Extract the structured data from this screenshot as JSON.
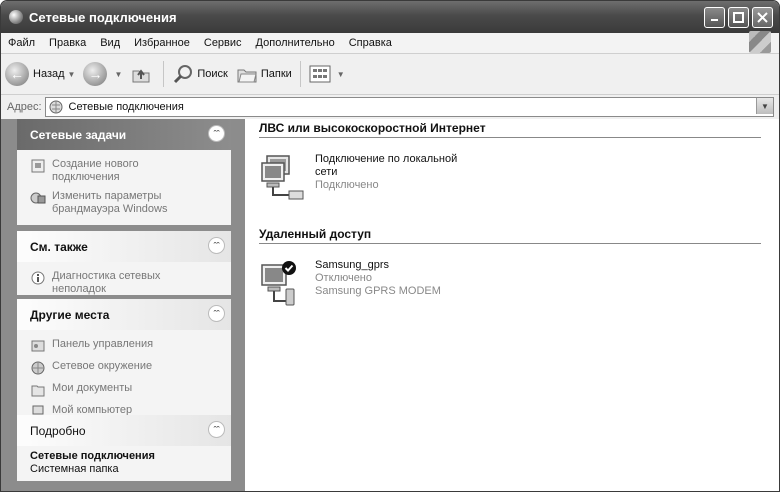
{
  "window": {
    "title": "Сетевые подключения"
  },
  "menu": [
    "Файл",
    "Правка",
    "Вид",
    "Избранное",
    "Сервис",
    "Дополнительно",
    "Справка"
  ],
  "toolbar": {
    "back": "Назад",
    "search": "Поиск",
    "folders": "Папки"
  },
  "address": {
    "label": "Адрес:",
    "value": "Сетевые подключения"
  },
  "sidebar": {
    "tasks": {
      "title": "Сетевые задачи",
      "items": [
        {
          "label": "Создание нового подключения",
          "icon": "new-connection-icon"
        },
        {
          "label": "Изменить параметры брандмауэра Windows",
          "icon": "firewall-icon"
        }
      ]
    },
    "see_also": {
      "title": "См. также",
      "items": [
        {
          "label": "Диагностика сетевых неполадок",
          "icon": "info-icon"
        }
      ]
    },
    "other_places": {
      "title": "Другие места",
      "items": [
        {
          "label": "Панель управления",
          "icon": "control-panel-icon"
        },
        {
          "label": "Сетевое окружение",
          "icon": "network-places-icon"
        },
        {
          "label": "Мои документы",
          "icon": "my-documents-icon"
        },
        {
          "label": "Мой компьютер",
          "icon": "my-computer-icon"
        }
      ]
    },
    "details": {
      "title": "Подробно",
      "name": "Сетевые подключения",
      "type": "Системная папка"
    }
  },
  "groups": {
    "lan": {
      "title": "ЛВС или высокоскоростной Интернет",
      "item": {
        "name": "Подключение по локальной сети",
        "status": "Подключено"
      }
    },
    "dialup": {
      "title": "Удаленный доступ",
      "item": {
        "name": "Samsung_gprs",
        "status": "Отключено",
        "device": "Samsung GPRS MODEM"
      }
    }
  }
}
